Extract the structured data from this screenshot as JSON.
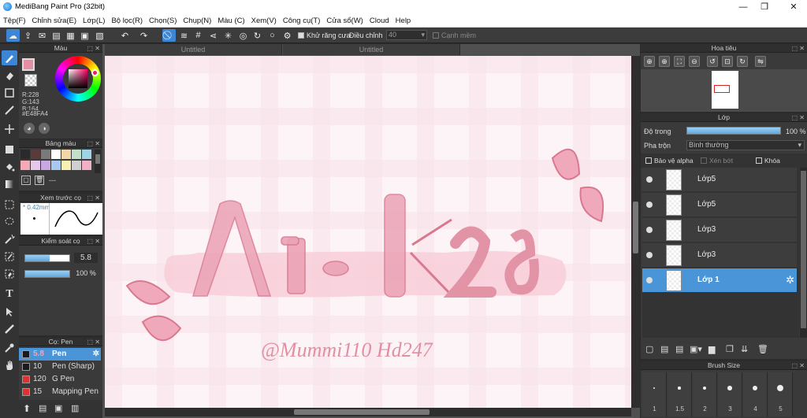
{
  "window": {
    "title": "MediBang Paint Pro (32bit)",
    "minimize": "—",
    "restore": "❐",
    "close": "✕"
  },
  "menu": [
    "Tệp(F)",
    "Chỉnh sửa(E)",
    "Lớp(L)",
    "Bộ lọc(R)",
    "Chọn(S)",
    "Chụp(N)",
    "Màu (C)",
    "Xem(V)",
    "Công cụ(T)",
    "Cửa sổ(W)",
    "Cloud",
    "Help"
  ],
  "toolbar": {
    "antialias_label": "Khử răng cưa",
    "adjust_label": "Điều chỉnh",
    "adjust_value": "40",
    "edge_label": "Cạnh mềm"
  },
  "color_panel": {
    "title": "Màu",
    "r": "R:228",
    "g": "G:143",
    "b": "B:164",
    "hex": "#E48FA4",
    "fg_color": "#E48FA4"
  },
  "palette_panel": {
    "title": "Bảng màu",
    "dash": "---",
    "swatches": [
      "#2a2a2a",
      "#5a3a3a",
      "#7a7a7a",
      "#ffffff",
      "#f3d6a8",
      "#c2e0c9",
      "#9fd4e6",
      "#f5a9b8",
      "#e8c8e8",
      "#c8a8e0",
      "#a8c8f0",
      "#f8f0b0",
      "#d0d0d0",
      "#f0b0c8"
    ]
  },
  "preview_panel": {
    "title": "Xem trước cọ",
    "size": "0.42mm"
  },
  "control_panel": {
    "title": "Kiểm soát cọ",
    "size_value": "5.8",
    "opacity_value": "100 %",
    "size_fraction": 0.55,
    "opacity_fraction": 1.0
  },
  "brush_panel": {
    "title": "Cọ: Pen",
    "brushes": [
      {
        "size": "5.8",
        "name": "Pen",
        "color": "#1a1a1a",
        "selected": true
      },
      {
        "size": "10",
        "name": "Pen (Sharp)",
        "color": "#1a1a1a",
        "selected": false
      },
      {
        "size": "120",
        "name": "G Pen",
        "color": "#e03030",
        "selected": false
      },
      {
        "size": "15",
        "name": "Mapping Pen",
        "color": "#e03030",
        "selected": false
      }
    ]
  },
  "tabs": [
    "Untitled",
    "Untitled"
  ],
  "artwork": {
    "main_text": "A1-K28",
    "signature": "@Mummi110 Hd247"
  },
  "navigator_panel": {
    "title": "Hoa tiêu"
  },
  "layer_panel": {
    "title": "Lớp",
    "opacity_label": "Độ trong",
    "opacity_value": "100 %",
    "opacity_fraction": 1.0,
    "blend_label": "Pha trộn",
    "blend_value": "Bình thường",
    "protect_alpha": "Bảo vệ alpha",
    "clipping": "Xén bớt",
    "lock": "Khóa",
    "layers": [
      {
        "name": "Lớp5",
        "selected": false
      },
      {
        "name": "Lớp5",
        "selected": false
      },
      {
        "name": "Lớp3",
        "selected": false
      },
      {
        "name": "Lớp3",
        "selected": false
      },
      {
        "name": "Lớp 1",
        "selected": true
      }
    ]
  },
  "brush_size_panel": {
    "title": "Brush Size",
    "sizes": [
      "1",
      "1.5",
      "2",
      "3",
      "4",
      "5"
    ]
  }
}
